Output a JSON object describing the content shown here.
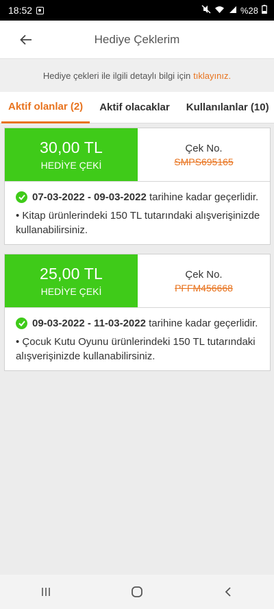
{
  "status": {
    "time": "18:52",
    "battery": "%28",
    "icons": [
      "notification-icon",
      "mute-icon",
      "wifi-icon",
      "signal-icon",
      "battery-icon"
    ]
  },
  "header": {
    "title": "Hediye Çeklerim",
    "back_icon": "arrow-left-icon"
  },
  "info": {
    "text": "Hediye çekleri ile ilgili detaylı bilgi için",
    "link": "tıklayınız."
  },
  "tabs": [
    {
      "label": "Aktif olanlar (2)",
      "active": true
    },
    {
      "label": "Aktif olacaklar",
      "active": false
    },
    {
      "label": "Kullanılanlar (10)",
      "active": false
    }
  ],
  "coupons": [
    {
      "amount": "30,00 TL",
      "kind": "HEDİYE ÇEKİ",
      "code_label": "Çek No.",
      "code": "SMPS695165",
      "dates": "07-03-2022 - 09-03-2022",
      "validity_suffix": "tarihine kadar geçerlidir.",
      "note": "• Kitap ürünlerindeki 150 TL tutarındaki alışverişinizde kullanabilirsiniz."
    },
    {
      "amount": "25,00 TL",
      "kind": "HEDİYE ÇEKİ",
      "code_label": "Çek No.",
      "code": "PFFM456668",
      "dates": "09-03-2022 - 11-03-2022",
      "validity_suffix": "tarihine kadar geçerlidir.",
      "note": "• Çocuk Kutu Oyunu ürünlerindeki 150 TL tutarındaki alışverişinizde kullanabilirsiniz."
    }
  ],
  "colors": {
    "accent": "#e8731e",
    "green": "#3fcb19",
    "background": "#ececec"
  }
}
